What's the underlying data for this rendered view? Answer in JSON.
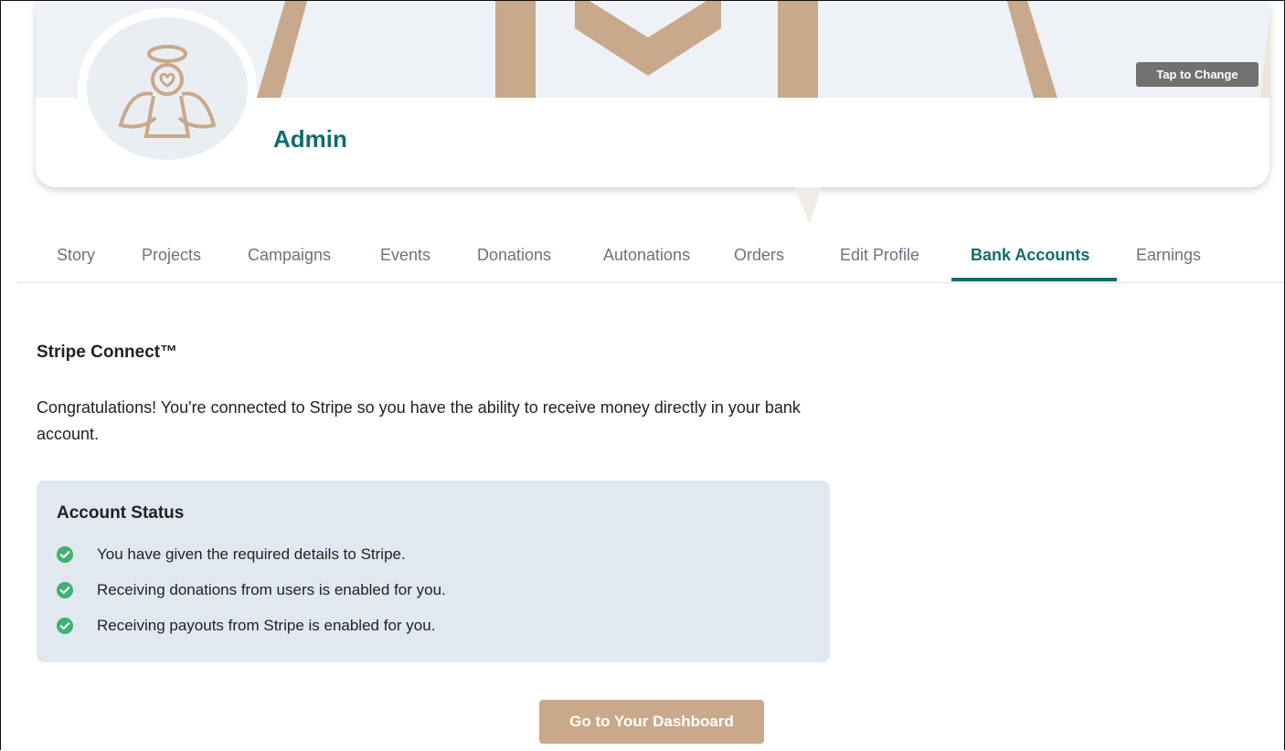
{
  "profile": {
    "name": "Admin",
    "tap_to_change": "Tap to Change"
  },
  "tabs": [
    {
      "label": "Story",
      "active": false
    },
    {
      "label": "Projects",
      "active": false
    },
    {
      "label": "Campaigns",
      "active": false
    },
    {
      "label": "Events",
      "active": false
    },
    {
      "label": "Donations",
      "active": false
    },
    {
      "label": "Autonations",
      "active": false
    },
    {
      "label": "Orders",
      "active": false
    },
    {
      "label": "Edit Profile",
      "active": false
    },
    {
      "label": "Bank Accounts",
      "active": true
    },
    {
      "label": "Earnings",
      "active": false
    }
  ],
  "stripe": {
    "title": "Stripe Connect™",
    "description": "Congratulations! You're connected to Stripe so you have the ability to receive money directly in your bank account."
  },
  "account_status": {
    "title": "Account Status",
    "items": [
      "You have given the required details to Stripe.",
      "Receiving donations from users is enabled for you.",
      "Receiving payouts from Stripe is enabled for you."
    ]
  },
  "dashboard_button": "Go to Your Dashboard",
  "colors": {
    "accent_teal": "#0f6e6b",
    "brand_tan": "#c9a989",
    "check_green": "#3cb371",
    "status_bg": "#e2e8ef"
  },
  "icons": {
    "avatar": "angel-heart-icon",
    "status_check": "check-circle-icon"
  }
}
